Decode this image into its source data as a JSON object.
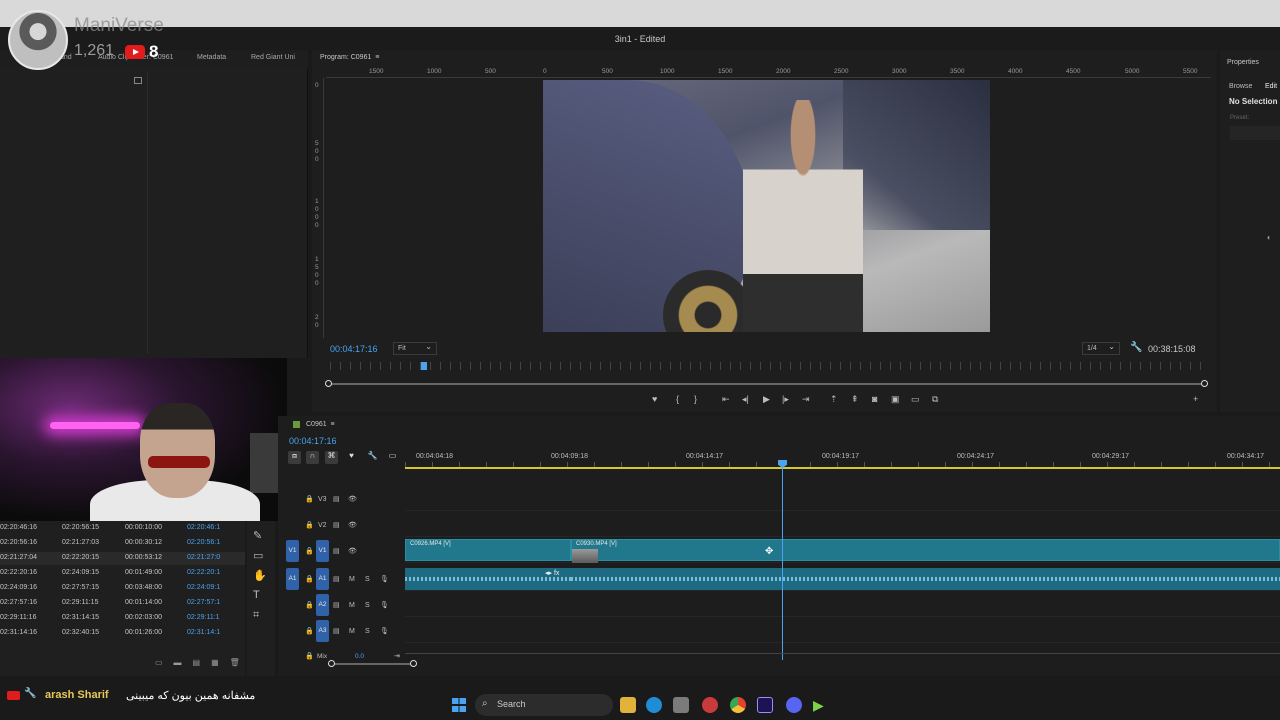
{
  "window": {
    "title": "3in1 - Edited"
  },
  "overlay": {
    "channel_name": "ManiVerse",
    "subscriber_count": "1,261",
    "youtube_count": "8"
  },
  "left_panel": {
    "tabs": [
      "und",
      "Audio Clip Mixer: C0961",
      "Metadata",
      "Red Giant Uni"
    ]
  },
  "monitor": {
    "tab": "Program: C0961",
    "ruler_labels": [
      "1500",
      "1000",
      "500",
      "0",
      "500",
      "1000",
      "1500",
      "2000",
      "2500",
      "3000",
      "3500",
      "4000",
      "4500",
      "5000",
      "5500"
    ],
    "vertical_labels": [
      "0",
      "5 0 0",
      "1 0 0 0",
      "1 5 0 0",
      "2 0"
    ],
    "current_time": "00:04:17:16",
    "zoom": "Fit",
    "resolution": "1/4",
    "duration": "00:38:15:08",
    "controls": [
      "marker-icon",
      "in-bracket",
      "out-bracket",
      "go-to-in",
      "step-back",
      "play",
      "step-forward",
      "go-to-out",
      "lift",
      "extract",
      "camera",
      "button-editor",
      "compare",
      "export"
    ]
  },
  "properties": {
    "title": "Properties",
    "browse": "Browse",
    "edit": "Edit",
    "selection": "No Selection",
    "preset": "Preset:"
  },
  "table": {
    "rows": [
      [
        "02:20:46:16",
        "02:20:56:15",
        "00:00:10:00",
        "02:20:46:1"
      ],
      [
        "02:20:56:16",
        "02:21:27:03",
        "00:00:30:12",
        "02:20:56:1"
      ],
      [
        "02:21:27:04",
        "02:22:20:15",
        "00:00:53:12",
        "02:21:27:0"
      ],
      [
        "02:22:20:16",
        "02:24:09:15",
        "00:01:49:00",
        "02:22:20:1"
      ],
      [
        "02:24:09:16",
        "02:27:57:15",
        "00:03:48:00",
        "02:24:09:1"
      ],
      [
        "02:27:57:16",
        "02:29:11:15",
        "00:01:14:00",
        "02:27:57:1"
      ],
      [
        "02:29:11:16",
        "02:31:14:15",
        "00:02:03:00",
        "02:29:11:1"
      ],
      [
        "02:31:14:16",
        "02:32:40:15",
        "00:01:26:00",
        "02:31:14:1"
      ]
    ]
  },
  "sequence": {
    "tab": "C0961",
    "current_time": "00:04:17:16",
    "ticks": [
      "00:04:04:18",
      "00:04:09:18",
      "00:04:14:17",
      "00:04:19:17",
      "00:04:24:17",
      "00:04:29:17",
      "00:04:34:17"
    ],
    "tracks": {
      "v3": "V3",
      "v2": "V2",
      "v1": "V1",
      "v1_src": "V1",
      "a1": "A1",
      "a1_src": "A1",
      "a2": "A2",
      "a3": "A3",
      "m": "M",
      "s": "S",
      "mix": "Mix",
      "mix_value": "0.0"
    },
    "clips": {
      "clip1": "C0926.MP4 [V]",
      "clip2": "C0930.MP4 [V]",
      "fx": "fx"
    }
  },
  "chat": {
    "user": "arash Sharif",
    "message": "مشفانه همین بیون که میبینی"
  },
  "taskbar": {
    "search": "Search"
  }
}
